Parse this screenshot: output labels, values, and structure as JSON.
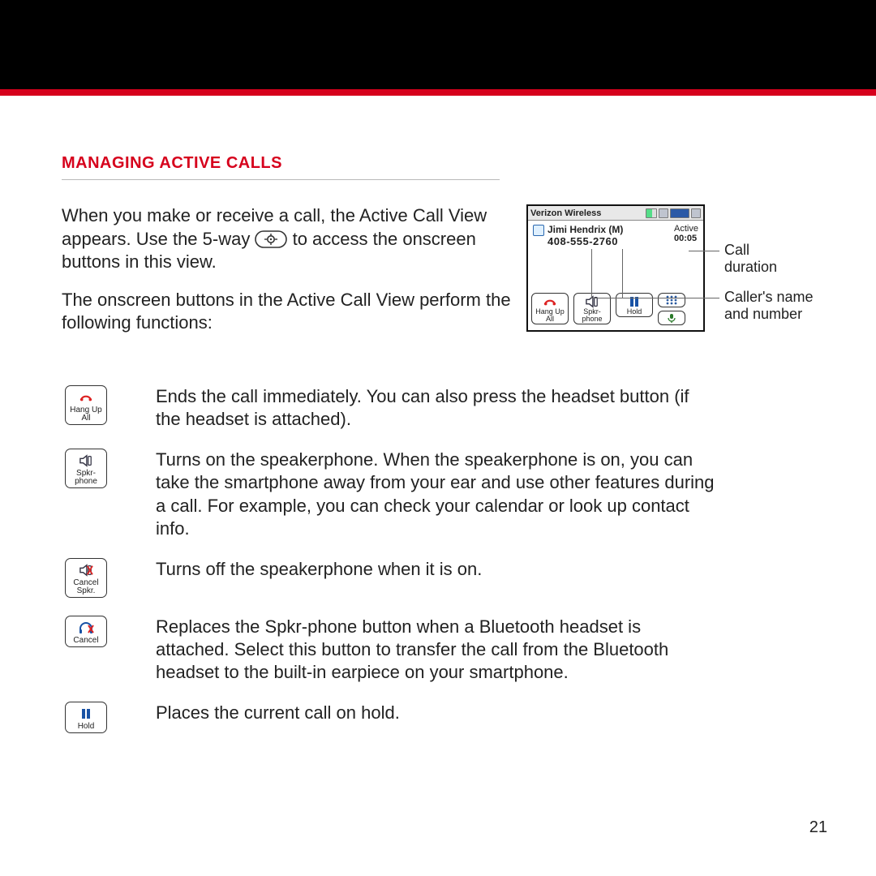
{
  "section_heading": "MANAGING ACTIVE CALLS",
  "intro": {
    "p1a": "When you make or receive a call, the Active Call View appears. Use the 5-way ",
    "p1b": " to access the onscreen buttons in this view.",
    "p2": "The onscreen buttons in the Active Call View perform the following functions:"
  },
  "screenshot": {
    "carrier": "Verizon Wireless",
    "caller_name": "Jimi Hendrix (M)",
    "caller_number": "408-555-2760",
    "status": "Active",
    "duration": "00:05",
    "buttons": {
      "hangup": "Hang Up All",
      "spkr": "Spkr- phone",
      "hold": "Hold"
    }
  },
  "callouts": {
    "duration": "Call duration",
    "caller": "Caller's name and number"
  },
  "functions": [
    {
      "icon": "phone-hangup-icon",
      "label": "Hang Up All",
      "desc": "Ends the call immediately. You can also press the headset button (if the headset is attached)."
    },
    {
      "icon": "speaker-on-icon",
      "label": "Spkr- phone",
      "desc": "Turns on the speakerphone. When the speakerphone is on, you can take the smartphone away from your ear and use other features during a call. For example, you can check your calendar or look up contact info."
    },
    {
      "icon": "speaker-cancel-icon",
      "label": "Cancel Spkr.",
      "desc": "Turns off the speakerphone when it is on."
    },
    {
      "icon": "headset-cancel-icon",
      "label": "Cancel",
      "desc": "Replaces the Spkr-phone button when a Bluetooth headset is attached. Select this button to transfer the call from the Bluetooth headset to the built-in earpiece on your smartphone."
    },
    {
      "icon": "hold-icon",
      "label": "Hold",
      "desc": "Places the current call on hold."
    }
  ],
  "page_number": "21"
}
